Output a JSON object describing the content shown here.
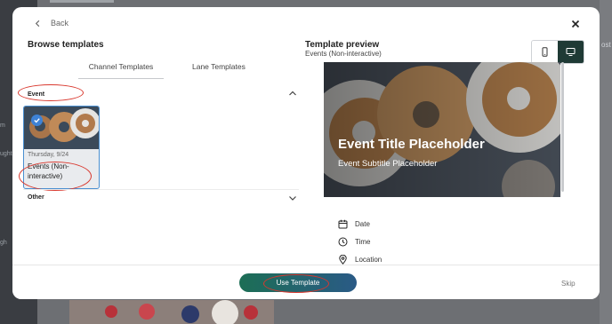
{
  "background": {
    "sidebar_labels": [
      "m",
      "ught",
      "gh"
    ],
    "right_label": "ost"
  },
  "modal": {
    "back_label": "Back",
    "browse_title": "Browse templates",
    "tabs": [
      {
        "label": "Channel Templates",
        "active": true
      },
      {
        "label": "Lane Templates",
        "active": false
      }
    ],
    "sections": [
      {
        "label": "Event",
        "expanded": true,
        "templates": [
          {
            "date": "Thursday, 9/24",
            "name": "Events (Non-interactive)",
            "selected": true
          }
        ]
      },
      {
        "label": "Other",
        "expanded": false
      }
    ],
    "preview": {
      "title": "Template preview",
      "subtitle": "Events (Non-interactive)",
      "view_mode": "desktop",
      "hero_title": "Event Title Placeholder",
      "hero_subtitle": "Event Subtitle Placeholder",
      "fields": [
        "Date",
        "Time",
        "Location"
      ]
    },
    "footer": {
      "use_label": "Use Template",
      "skip_label": "Skip"
    }
  },
  "colors": {
    "annotation": "#d9382e",
    "selected_border": "#4a8fd1",
    "desktop_toggle": "#1f3a35",
    "button_gradient_start": "#1c6e55",
    "button_gradient_end": "#2a5a86"
  }
}
